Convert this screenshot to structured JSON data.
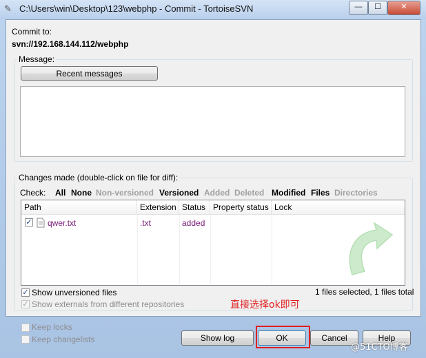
{
  "window": {
    "title": "C:\\Users\\win\\Desktop\\123\\webphp - Commit - TortoiseSVN",
    "icon": "tortoisesvn-icon",
    "controls": {
      "minimize": "—",
      "maximize": "☐",
      "close": "✕"
    }
  },
  "commit": {
    "commit_to_label": "Commit to:",
    "url": "svn://192.168.144.112/webphp"
  },
  "message": {
    "group_label": "Message:",
    "recent_button": "Recent messages",
    "text": ""
  },
  "changes": {
    "group_label": "Changes made (double-click on file for diff):",
    "check_label": "Check:",
    "filters": {
      "all": "All",
      "none": "None",
      "non_versioned": "Non-versioned",
      "versioned": "Versioned",
      "added": "Added",
      "deleted": "Deleted",
      "modified": "Modified",
      "files": "Files",
      "directories": "Directories"
    },
    "columns": {
      "path": "Path",
      "extension": "Extension",
      "status": "Status",
      "property_status": "Property status",
      "lock": "Lock"
    },
    "rows": [
      {
        "checked": true,
        "path": "qwer.txt",
        "extension": ".txt",
        "status": "added",
        "property_status": "",
        "lock": ""
      }
    ],
    "show_unversioned": "Show unversioned files",
    "show_externals": "Show externals from different repositories",
    "summary": "1 files selected, 1 files total",
    "annotation": "直接选择ok即可"
  },
  "footer": {
    "keep_locks": "Keep locks",
    "keep_changelists": "Keep changelists",
    "show_log": "Show log",
    "ok": "OK",
    "cancel": "Cancel",
    "help": "Help",
    "watermark": "@51CTO博客"
  },
  "colors": {
    "annotation_red": "#e02020",
    "added_purple": "#7a1a7a",
    "disabled_gray": "#a0a0a0",
    "titlebar_blue": "#b8cfec"
  }
}
